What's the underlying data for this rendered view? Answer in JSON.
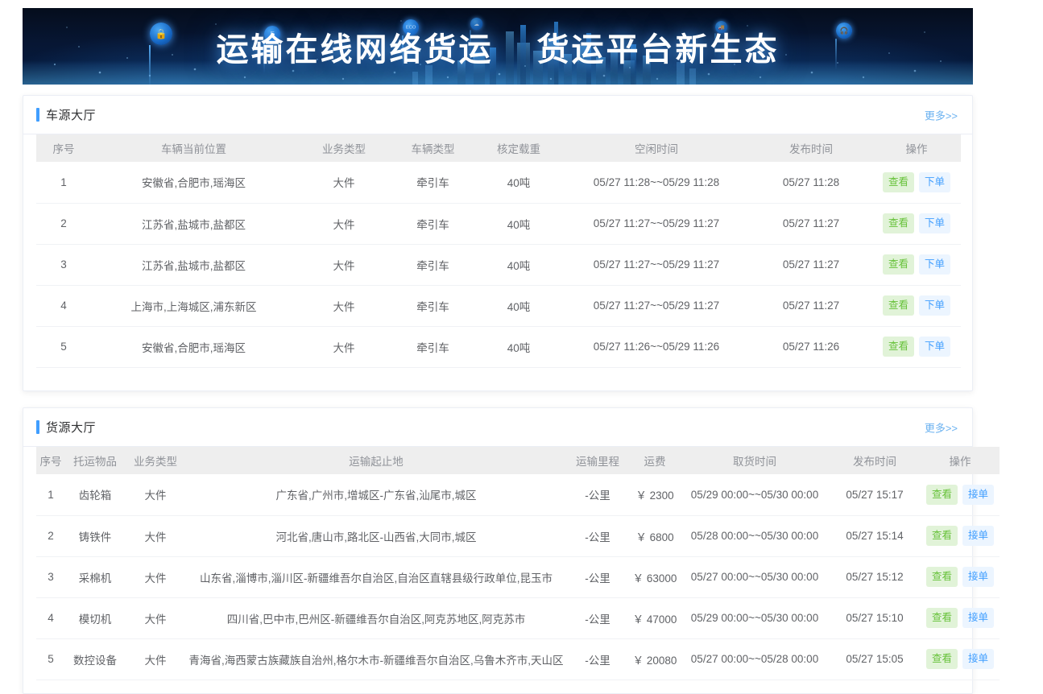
{
  "banner": {
    "title_part1": "运输在线网络货运",
    "title_part2": "货运平台新生态",
    "icons": [
      "lock-icon",
      "f-icon",
      "eco-icon",
      "truck-icon",
      "headset-icon",
      "cloud-icon"
    ]
  },
  "vehicle_section": {
    "title": "车源大厅",
    "more_label": "更多>>",
    "columns": [
      "序号",
      "车辆当前位置",
      "业务类型",
      "车辆类型",
      "核定载重",
      "空闲时间",
      "发布时间",
      "操作"
    ],
    "rows": [
      {
        "index": "1",
        "location": "安徽省,合肥市,瑶海区",
        "business_type": "大件",
        "vehicle_type": "牵引车",
        "rated_load": "40吨",
        "idle_time": "05/27 11:28~~05/29 11:28",
        "publish_time": "05/27 11:28",
        "btn_view": "查看",
        "btn_order": "下单"
      },
      {
        "index": "2",
        "location": "江苏省,盐城市,盐都区",
        "business_type": "大件",
        "vehicle_type": "牵引车",
        "rated_load": "40吨",
        "idle_time": "05/27 11:27~~05/29 11:27",
        "publish_time": "05/27 11:27",
        "btn_view": "查看",
        "btn_order": "下单"
      },
      {
        "index": "3",
        "location": "江苏省,盐城市,盐都区",
        "business_type": "大件",
        "vehicle_type": "牵引车",
        "rated_load": "40吨",
        "idle_time": "05/27 11:27~~05/29 11:27",
        "publish_time": "05/27 11:27",
        "btn_view": "查看",
        "btn_order": "下单"
      },
      {
        "index": "4",
        "location": "上海市,上海城区,浦东新区",
        "business_type": "大件",
        "vehicle_type": "牵引车",
        "rated_load": "40吨",
        "idle_time": "05/27 11:27~~05/29 11:27",
        "publish_time": "05/27 11:27",
        "btn_view": "查看",
        "btn_order": "下单"
      },
      {
        "index": "5",
        "location": "安徽省,合肥市,瑶海区",
        "business_type": "大件",
        "vehicle_type": "牵引车",
        "rated_load": "40吨",
        "idle_time": "05/27 11:26~~05/29 11:26",
        "publish_time": "05/27 11:26",
        "btn_view": "查看",
        "btn_order": "下单"
      }
    ]
  },
  "cargo_section": {
    "title": "货源大厅",
    "more_label": "更多>>",
    "columns": [
      "序号",
      "托运物品",
      "业务类型",
      "运输起止地",
      "运输里程",
      "运费",
      "取货时间",
      "发布时间",
      "操作"
    ],
    "rows": [
      {
        "index": "1",
        "goods": "齿轮箱",
        "business_type": "大件",
        "route": "广东省,广州市,增城区-广东省,汕尾市,城区",
        "distance": "-公里",
        "freight": "￥ 2300",
        "pickup_time": "05/29 00:00~~05/30 00:00",
        "publish_time": "05/27 15:17",
        "btn_view": "查看",
        "btn_accept": "接单"
      },
      {
        "index": "2",
        "goods": "铸铁件",
        "business_type": "大件",
        "route": "河北省,唐山市,路北区-山西省,大同市,城区",
        "distance": "-公里",
        "freight": "￥ 6800",
        "pickup_time": "05/28 00:00~~05/30 00:00",
        "publish_time": "05/27 15:14",
        "btn_view": "查看",
        "btn_accept": "接单"
      },
      {
        "index": "3",
        "goods": "采棉机",
        "business_type": "大件",
        "route": "山东省,淄博市,淄川区-新疆维吾尔自治区,自治区直辖县级行政单位,昆玉市",
        "distance": "-公里",
        "freight": "￥ 63000",
        "pickup_time": "05/27 00:00~~05/30 00:00",
        "publish_time": "05/27 15:12",
        "btn_view": "查看",
        "btn_accept": "接单"
      },
      {
        "index": "4",
        "goods": "模切机",
        "business_type": "大件",
        "route": "四川省,巴中市,巴州区-新疆维吾尔自治区,阿克苏地区,阿克苏市",
        "distance": "-公里",
        "freight": "￥ 47000",
        "pickup_time": "05/29 00:00~~05/30 00:00",
        "publish_time": "05/27 15:10",
        "btn_view": "查看",
        "btn_accept": "接单"
      },
      {
        "index": "5",
        "goods": "数控设备",
        "business_type": "大件",
        "route": "青海省,海西蒙古族藏族自治州,格尔木市-新疆维吾尔自治区,乌鲁木齐市,天山区",
        "distance": "-公里",
        "freight": "￥ 20080",
        "pickup_time": "05/27 00:00~~05/28 00:00",
        "publish_time": "05/27 15:05",
        "btn_view": "查看",
        "btn_accept": "接单"
      }
    ]
  },
  "colors": {
    "accent": "#409eff",
    "view_btn_bg": "#e1f3d8",
    "view_btn_text": "#67c23a",
    "order_btn_bg": "#ecf5ff",
    "order_btn_text": "#409eff",
    "header_bg": "#eeeeee",
    "banner_bg": "#061633"
  }
}
